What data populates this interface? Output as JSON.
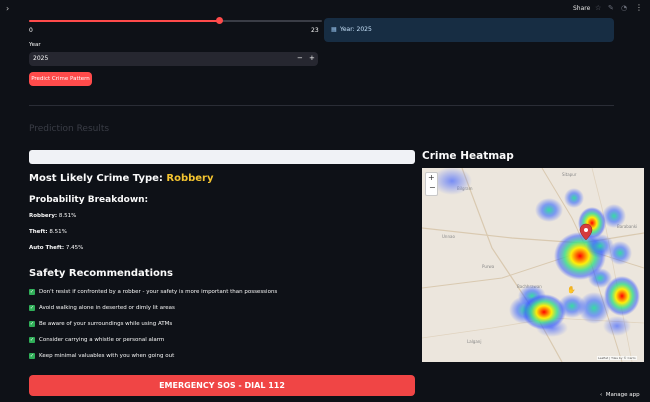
{
  "header": {
    "share_label": "Share",
    "menu_label": "⋮",
    "collapse_label": "›",
    "icons": [
      "star-icon",
      "edit-icon",
      "github-icon"
    ]
  },
  "slider": {
    "min": "0",
    "max": "23",
    "value_fraction": 0.65
  },
  "info": {
    "icon": "calendar-icon",
    "text": "Year: 2025"
  },
  "year_input": {
    "label": "Year",
    "value": "2025",
    "minus": "−",
    "plus": "+"
  },
  "predict_button": {
    "label": "Predict Crime Pattern"
  },
  "results": {
    "section_title": "Prediction Results",
    "likely_prefix": "Most Likely Crime Type: ",
    "likely_value": "Robbery",
    "breakdown_title": "Probability Breakdown:",
    "breakdown": [
      {
        "name": "Robbery:",
        "value": "8.51%"
      },
      {
        "name": "Theft:",
        "value": "8.51%"
      },
      {
        "name": "Auto Theft:",
        "value": "7.45%"
      }
    ],
    "safety_title": "Safety Recommendations",
    "recommendations": [
      "Don't resist if confronted by a robber - your safety is more important than possessions",
      "Avoid walking alone in deserted or dimly lit areas",
      "Be aware of your surroundings while using ATMs",
      "Consider carrying a whistle or personal alarm",
      "Keep minimal valuables with you when going out"
    ],
    "sos_label": "EMERGENCY SOS - DIAL 112"
  },
  "heatmap": {
    "title": "Crime Heatmap",
    "zoom_in": "+",
    "zoom_out": "−",
    "attribution": "Leaflet | Tiles by © Carto"
  },
  "footer": {
    "manage_label": "Manage app",
    "chevron": "‹"
  },
  "colors": {
    "accent": "#ff4b4b",
    "highlight": "#f4c430",
    "info_bg": "#172d43",
    "check": "#2fae58"
  }
}
